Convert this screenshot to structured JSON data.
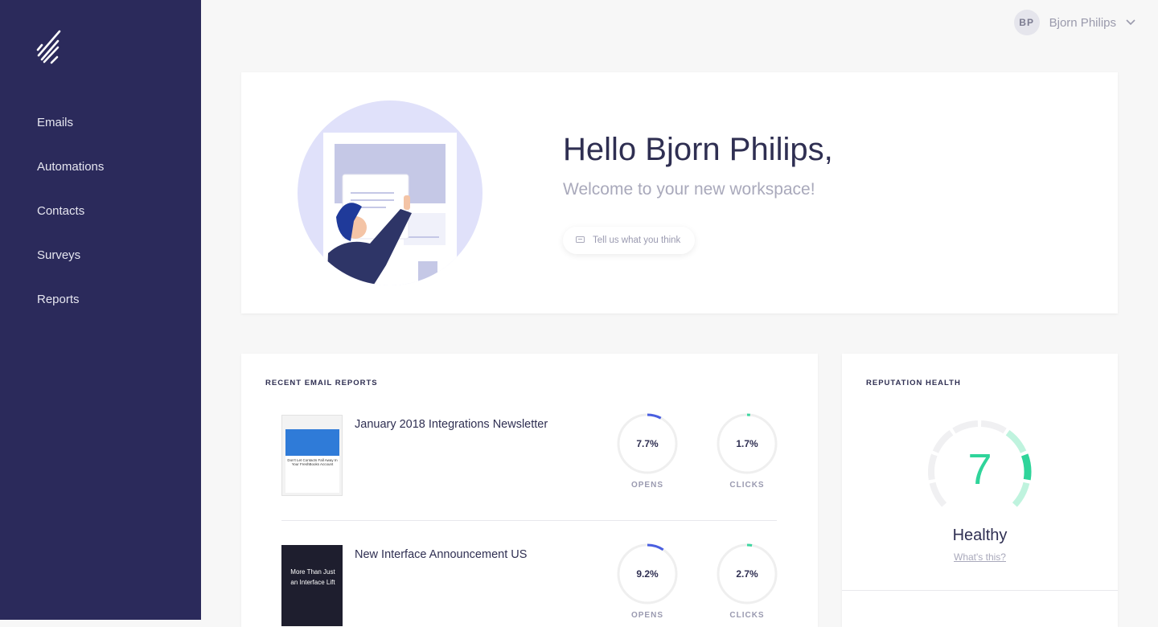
{
  "sidebar": {
    "items": [
      {
        "label": "Emails"
      },
      {
        "label": "Automations"
      },
      {
        "label": "Contacts"
      },
      {
        "label": "Surveys"
      },
      {
        "label": "Reports"
      }
    ]
  },
  "user": {
    "initials": "BP",
    "name": "Bjorn Philips"
  },
  "hero": {
    "greeting": "Hello Bjorn Philips,",
    "subtitle": "Welcome to your new workspace!",
    "feedback_label": "Tell us what you think"
  },
  "reports": {
    "title": "RECENT EMAIL REPORTS",
    "rows": [
      {
        "name": "January 2018 Integrations Newsletter",
        "opens": "7.7%",
        "opens_value": 7.7,
        "clicks": "1.7%",
        "clicks_value": 1.7,
        "opens_label": "OPENS",
        "clicks_label": "CLICKS",
        "thumb_headline": "Don't Let Contacts Fall Away In Your FreshBooks Account"
      },
      {
        "name": "New Interface Announcement US",
        "opens": "9.2%",
        "opens_value": 9.2,
        "clicks": "2.7%",
        "clicks_value": 2.7,
        "opens_label": "OPENS",
        "clicks_label": "CLICKS",
        "thumb_headline": "More Than Just an Interface Lift"
      }
    ]
  },
  "reputation": {
    "title": "REPUTATION HEALTH",
    "score": "7",
    "status": "Healthy",
    "link": "What's this?",
    "segments": 8
  },
  "colors": {
    "sidebar": "#2b2a5b",
    "opens": "#4a5fe0",
    "clicks": "#3ed6a0",
    "healthy": "#2fd49a"
  }
}
